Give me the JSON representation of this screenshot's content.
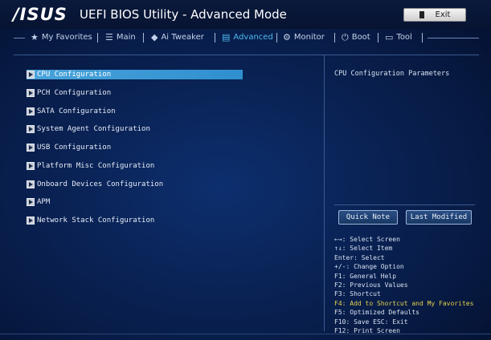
{
  "header": {
    "logo": "/ISUS",
    "title": "UEFI BIOS Utility - Advanced Mode",
    "exit_label": "Exit"
  },
  "menu": {
    "items": [
      {
        "label": "My Favorites",
        "icon": "star-icon"
      },
      {
        "label": "Main",
        "icon": "list-icon"
      },
      {
        "label": "Ai Tweaker",
        "icon": "tweaker-icon"
      },
      {
        "label": "Advanced",
        "icon": "advanced-icon",
        "active": true
      },
      {
        "label": "Monitor",
        "icon": "monitor-icon"
      },
      {
        "label": "Boot",
        "icon": "power-icon"
      },
      {
        "label": "Tool",
        "icon": "tool-icon"
      }
    ]
  },
  "main": {
    "items": [
      {
        "label": "CPU Configuration",
        "selected": true
      },
      {
        "label": "PCH Configuration"
      },
      {
        "label": "SATA Configuration"
      },
      {
        "label": "System Agent Configuration"
      },
      {
        "label": "USB Configuration"
      },
      {
        "label": "Platform Misc Configuration"
      },
      {
        "label": "Onboard Devices Configuration"
      },
      {
        "label": "APM"
      },
      {
        "label": "Network Stack Configuration"
      }
    ]
  },
  "help": {
    "description": "CPU Configuration Parameters",
    "quick_note": "Quick Note",
    "last_modified": "Last Modified",
    "keys": [
      "←→: Select Screen",
      "↑↓: Select Item",
      "Enter: Select",
      "+/-: Change Option",
      "F1: General Help",
      "F2: Previous Values",
      "F3: Shortcut",
      "F4: Add to Shortcut and My Favorites",
      "F5: Optimized Defaults",
      "F10: Save  ESC: Exit",
      "F12: Print Screen"
    ]
  },
  "colors": {
    "accent": "#4fb8f0",
    "highlight": "#e5d04b",
    "selection": "#3d9ad6"
  }
}
